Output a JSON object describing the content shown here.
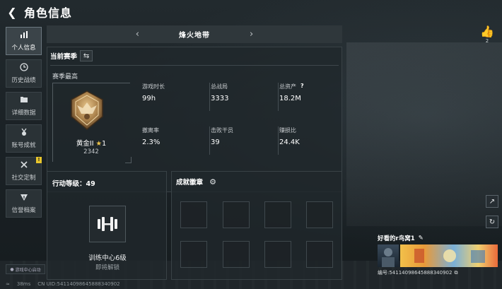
{
  "header": {
    "title": "角色信息"
  },
  "nav": {
    "items": [
      {
        "label": "个人信息",
        "icon": "bar-chart-icon"
      },
      {
        "label": "历史战绩",
        "icon": "clock-icon"
      },
      {
        "label": "详细数据",
        "icon": "folder-icon"
      },
      {
        "label": "账号成就",
        "icon": "medal-icon"
      },
      {
        "label": "社交定制",
        "icon": "tools-icon",
        "badge": "!"
      },
      {
        "label": "信誉档案",
        "icon": "shield-icon"
      }
    ],
    "footer": "游戏中心启动"
  },
  "season_bar": {
    "name": "烽火地带"
  },
  "current_season": {
    "label": "当前赛季",
    "sub": "赛季最高",
    "rank": {
      "name": "黄金II",
      "stars": "1",
      "points": "2342"
    },
    "stats": [
      {
        "key": "游戏时长",
        "value": "99h"
      },
      {
        "key": "总战局",
        "value": "3333"
      },
      {
        "key": "总资产",
        "value": "18.2M",
        "help": "?"
      },
      {
        "key": "撤离率",
        "value": "2.3%"
      },
      {
        "key": "击败干员",
        "value": "39"
      },
      {
        "key": "赚损比",
        "value": "24.4K"
      }
    ]
  },
  "action_level": {
    "title": "行动等级：49",
    "name": "训练中心6级",
    "status": "即将解锁"
  },
  "achievements": {
    "label": "成就徽章"
  },
  "like": {
    "count": "2"
  },
  "profile": {
    "name": "好看的r鸟窝1",
    "id": "编号:541140986458883409​02"
  },
  "bottom": {
    "ping": "38ms",
    "uid": "CN UID:541140986458883409​02"
  },
  "colors": {
    "accent_gold": "#f0c64a",
    "badge_yellow": "#e8c62c"
  }
}
